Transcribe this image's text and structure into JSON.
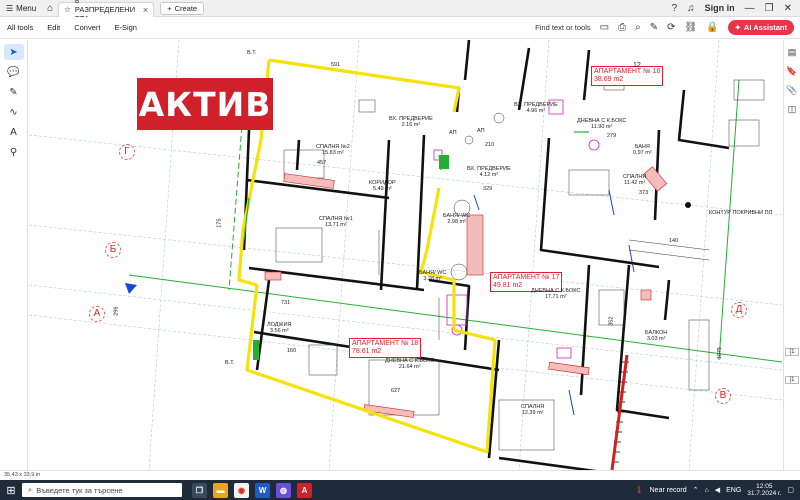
{
  "titlebar": {
    "menu_label": "Menu",
    "tab_title": "8 РАЗПРЕДЕЛЕНИ ЕТА...",
    "create_label": "Create",
    "sign_in": "Sign in"
  },
  "menubar": {
    "items": [
      "All tools",
      "Edit",
      "Convert",
      "E-Sign"
    ],
    "find_label": "Find text or tools",
    "ai_label": "AI Assistant"
  },
  "plan": {
    "watermark": "АКТИВ",
    "axes": [
      "Г",
      "Б",
      "А",
      "Д",
      "В"
    ],
    "apartments": [
      {
        "title": "АПАРТАМЕНТ № 16",
        "area": "38.69 m2"
      },
      {
        "title": "АПАРТАМЕНТ № 17",
        "area": "49.81 m2"
      },
      {
        "title": "АПАРТАМЕНТ № 18",
        "area": "78.61 m2"
      }
    ],
    "rooms": [
      {
        "name": "ВХ. ПРЕДВЕРИЕ",
        "area": "2.16 m²"
      },
      {
        "name": "СПАЛНЯ №2",
        "area": "15.83 m²"
      },
      {
        "name": "КОРИДОР",
        "area": "5.49 m²"
      },
      {
        "name": "СПАЛНЯ №1",
        "area": "13.71 m²"
      },
      {
        "name": "ВХ. ПРЕДВЕРИЕ",
        "area": "4.96 m²"
      },
      {
        "name": "ДНЕВНА С К.БОКС",
        "area": "11.90 m²"
      },
      {
        "name": "БАНЯ",
        "area": "0.97 m²"
      },
      {
        "name": "ВХ. ПРЕДВЕРИЕ",
        "area": "4.12 m²"
      },
      {
        "name": "СПАЛНЯ",
        "area": "11.42 m²"
      },
      {
        "name": "БАНЯ/ WC",
        "area": "2.98 m²"
      },
      {
        "name": "БАНЯ/ WC",
        "area": "3.28 m²"
      },
      {
        "name": "ДНЕВНА С К.БОКС",
        "area": "17.71 m²"
      },
      {
        "name": "ЛОДЖИЯ",
        "area": "3.56 m²"
      },
      {
        "name": "ДНЕВНА С К.БОКС",
        "area": "21.64 m²"
      },
      {
        "name": "БАЛКОН",
        "area": "3.03 m²"
      },
      {
        "name": "СПАЛНЯ",
        "area": "12.39 m²"
      }
    ],
    "notes": {
      "kontur": "КОНТУР ПОКРИВНИ ПЛ",
      "ap1": "АП",
      "ap2": "АП",
      "num12": "12",
      "bt1": "В.Т.",
      "bt2": "В.Т.",
      "dims": [
        "457",
        "591",
        "627",
        "731",
        "329",
        "373",
        "279",
        "352",
        "1075",
        "296",
        "175",
        "140",
        "210",
        "160"
      ]
    }
  },
  "rightbar": {
    "page_up": "[1",
    "page_down": "[1"
  },
  "status": {
    "size": "35,43 x 33,9 in"
  },
  "taskbar": {
    "search_placeholder": "Въведете тук за търсене",
    "weather": "Near record",
    "lang": "ENG",
    "time": "12:05",
    "date": "31.7.2024 г."
  }
}
